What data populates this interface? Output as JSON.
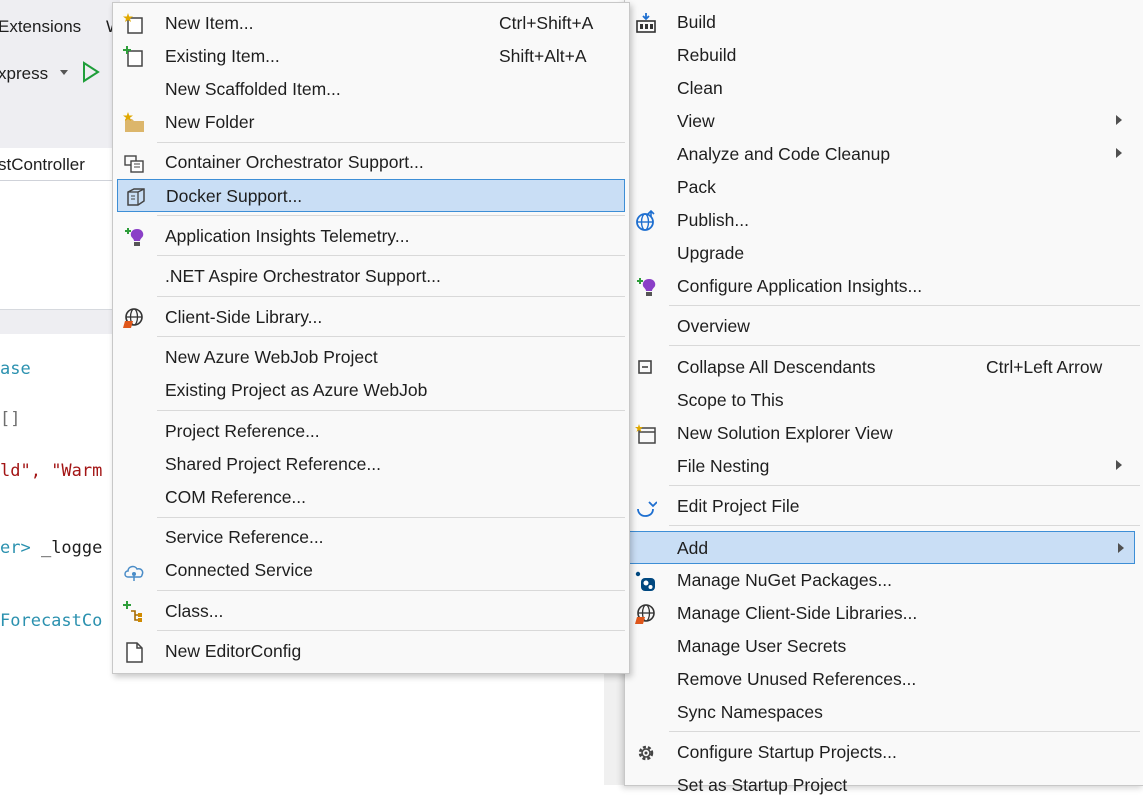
{
  "ide": {
    "menu_extensions": "Extensions",
    "menu_partial": "W",
    "toolbar_target": "xpress",
    "editor_tab": "stController",
    "code_lines": [
      {
        "a": "ase",
        "b": ""
      },
      {
        "a": "[]",
        "b": ""
      },
      {
        "a": "ld\"",
        "b": ", \"Warm"
      },
      {
        "a": "er>",
        "b": " _logge"
      },
      {
        "a": "ForecastCo",
        "b": ""
      }
    ]
  },
  "context_menu": {
    "items": [
      {
        "label": "Build",
        "icon": "build-icon"
      },
      {
        "label": "Rebuild"
      },
      {
        "label": "Clean"
      },
      {
        "label": "View",
        "submenu": true
      },
      {
        "label": "Analyze and Code Cleanup",
        "submenu": true
      },
      {
        "label": "Pack"
      },
      {
        "label": "Publish...",
        "icon": "publish-globe-icon"
      },
      {
        "label": "Upgrade"
      },
      {
        "label": "Configure Application Insights...",
        "icon": "app-insights-icon"
      },
      {
        "label": "Overview"
      },
      {
        "label": "Collapse All Descendants",
        "shortcut": "Ctrl+Left Arrow",
        "icon": "collapse-icon"
      },
      {
        "label": "Scope to This"
      },
      {
        "label": "New Solution Explorer View",
        "icon": "new-solution-view-icon"
      },
      {
        "label": "File Nesting",
        "submenu": true
      },
      {
        "label": "Edit Project File",
        "icon": "edit-project-icon"
      },
      {
        "label": "Add",
        "submenu": true,
        "selected": true
      },
      {
        "label": "Manage NuGet Packages...",
        "icon": "nuget-icon"
      },
      {
        "label": "Manage Client-Side Libraries...",
        "icon": "client-libraries-icon"
      },
      {
        "label": "Manage User Secrets"
      },
      {
        "label": "Remove Unused References..."
      },
      {
        "label": "Sync Namespaces"
      },
      {
        "label": "Configure Startup Projects...",
        "icon": "gear-icon"
      },
      {
        "label": "Set as Startup Project"
      }
    ]
  },
  "add_submenu": {
    "items": [
      {
        "label": "New Item...",
        "shortcut": "Ctrl+Shift+A",
        "icon": "new-item-icon"
      },
      {
        "label": "Existing Item...",
        "shortcut": "Shift+Alt+A",
        "icon": "existing-item-icon"
      },
      {
        "label": "New Scaffolded Item..."
      },
      {
        "label": "New Folder",
        "icon": "new-folder-icon"
      },
      {
        "label": "Container Orchestrator Support...",
        "icon": "container-orchestrator-icon"
      },
      {
        "label": "Docker Support...",
        "icon": "docker-icon",
        "selected": true
      },
      {
        "label": "Application Insights Telemetry...",
        "icon": "app-insights-icon"
      },
      {
        "label": ".NET Aspire Orchestrator Support..."
      },
      {
        "label": "Client-Side Library...",
        "icon": "client-library-icon"
      },
      {
        "label": "New Azure WebJob Project"
      },
      {
        "label": "Existing Project as Azure WebJob"
      },
      {
        "label": "Project Reference..."
      },
      {
        "label": "Shared Project Reference..."
      },
      {
        "label": "COM Reference..."
      },
      {
        "label": "Service Reference..."
      },
      {
        "label": "Connected Service",
        "icon": "connected-service-icon"
      },
      {
        "label": "Class...",
        "icon": "class-icon"
      },
      {
        "label": "New EditorConfig",
        "icon": "editorconfig-icon"
      }
    ]
  }
}
